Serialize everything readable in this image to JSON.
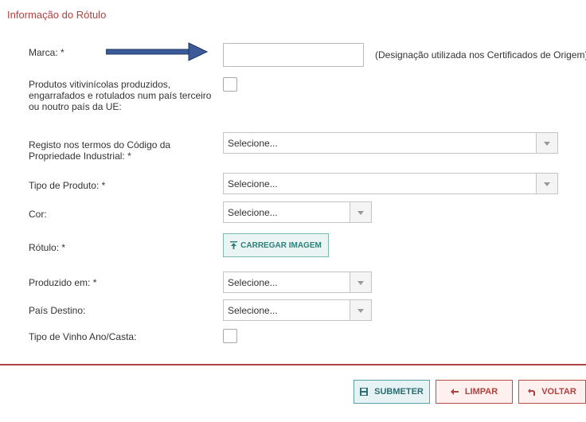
{
  "section": {
    "title": "Informação do Rótulo"
  },
  "fields": {
    "marca": {
      "label": "Marca: *",
      "value": "",
      "hint": "(Designação utilizada nos Certificados de Origem)"
    },
    "produtos": {
      "label": "Produtos vitivinícolas produzidos, engarrafados e rotulados num país terceiro ou noutro país da UE:",
      "checked": false
    },
    "registo": {
      "label": "Registo nos termos do Código da Propriedade Industrial: *",
      "selected": "Selecione..."
    },
    "tipo_produto": {
      "label": "Tipo de Produto: *",
      "selected": "Selecione..."
    },
    "cor": {
      "label": "Cor:",
      "selected": "Selecione..."
    },
    "rotulo": {
      "label": "Rótulo: *",
      "upload_label": "CARREGAR IMAGEM"
    },
    "produzido_em": {
      "label": "Produzido em: *",
      "selected": "Selecione..."
    },
    "pais_destino": {
      "label": "País Destino:",
      "selected": "Selecione..."
    },
    "tipo_vinho": {
      "label": "Tipo de Vinho Ano/Casta:",
      "checked": false
    }
  },
  "footer": {
    "submit_label": "SUBMETER",
    "clear_label": "LIMPAR",
    "back_label": "VOLTAR"
  },
  "icons": {
    "upload": "upload-icon",
    "submit": "save-icon",
    "clear": "arrow-left-icon",
    "back": "undo-icon",
    "annotation": "arrow-right-icon"
  },
  "colors": {
    "accent_red": "#b0413e",
    "teal": "#2f7f78",
    "annotation_arrow": "#3b5a9a"
  }
}
